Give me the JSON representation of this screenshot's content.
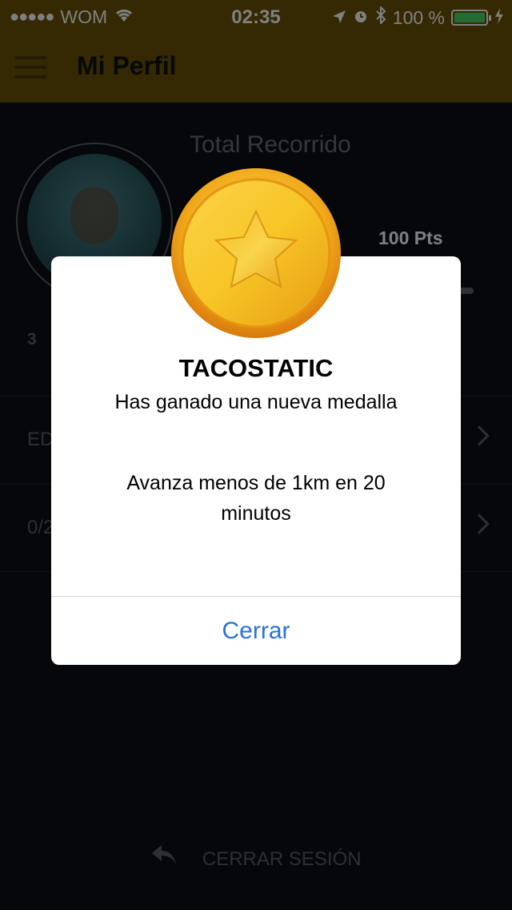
{
  "status_bar": {
    "signal_dots": "●●●●●",
    "carrier": "WOM",
    "time": "02:35",
    "battery_percent": "100 %",
    "icons": [
      "wifi-icon",
      "location-arrow-icon",
      "alarm-icon",
      "bluetooth-icon",
      "battery-icon",
      "charging-icon"
    ]
  },
  "nav": {
    "title": "Mi Perfil",
    "menu_icon": "hamburger-menu-icon"
  },
  "profile": {
    "total_label": "Total Recorrido",
    "points": "100 Pts",
    "progress": 1.0,
    "small_number": "3"
  },
  "rows": [
    {
      "label": "ED"
    },
    {
      "label": "0/2"
    }
  ],
  "logout": {
    "icon": "undo-arrow-icon",
    "label": "CERRAR SESIÓN"
  },
  "modal": {
    "medal_icon": "gold-star-medal-icon",
    "title": "TACOSTATIC",
    "subtitle": "Has ganado una nueva medalla",
    "description": "Avanza menos de 1km en 20 minutos",
    "button": "Cerrar"
  },
  "colors": {
    "header": "#6b5306",
    "accent_blue": "#2b71d9",
    "medal_gold": "#f2b91c",
    "medal_edge": "#e48a0f",
    "battery_green": "#4cd964"
  }
}
